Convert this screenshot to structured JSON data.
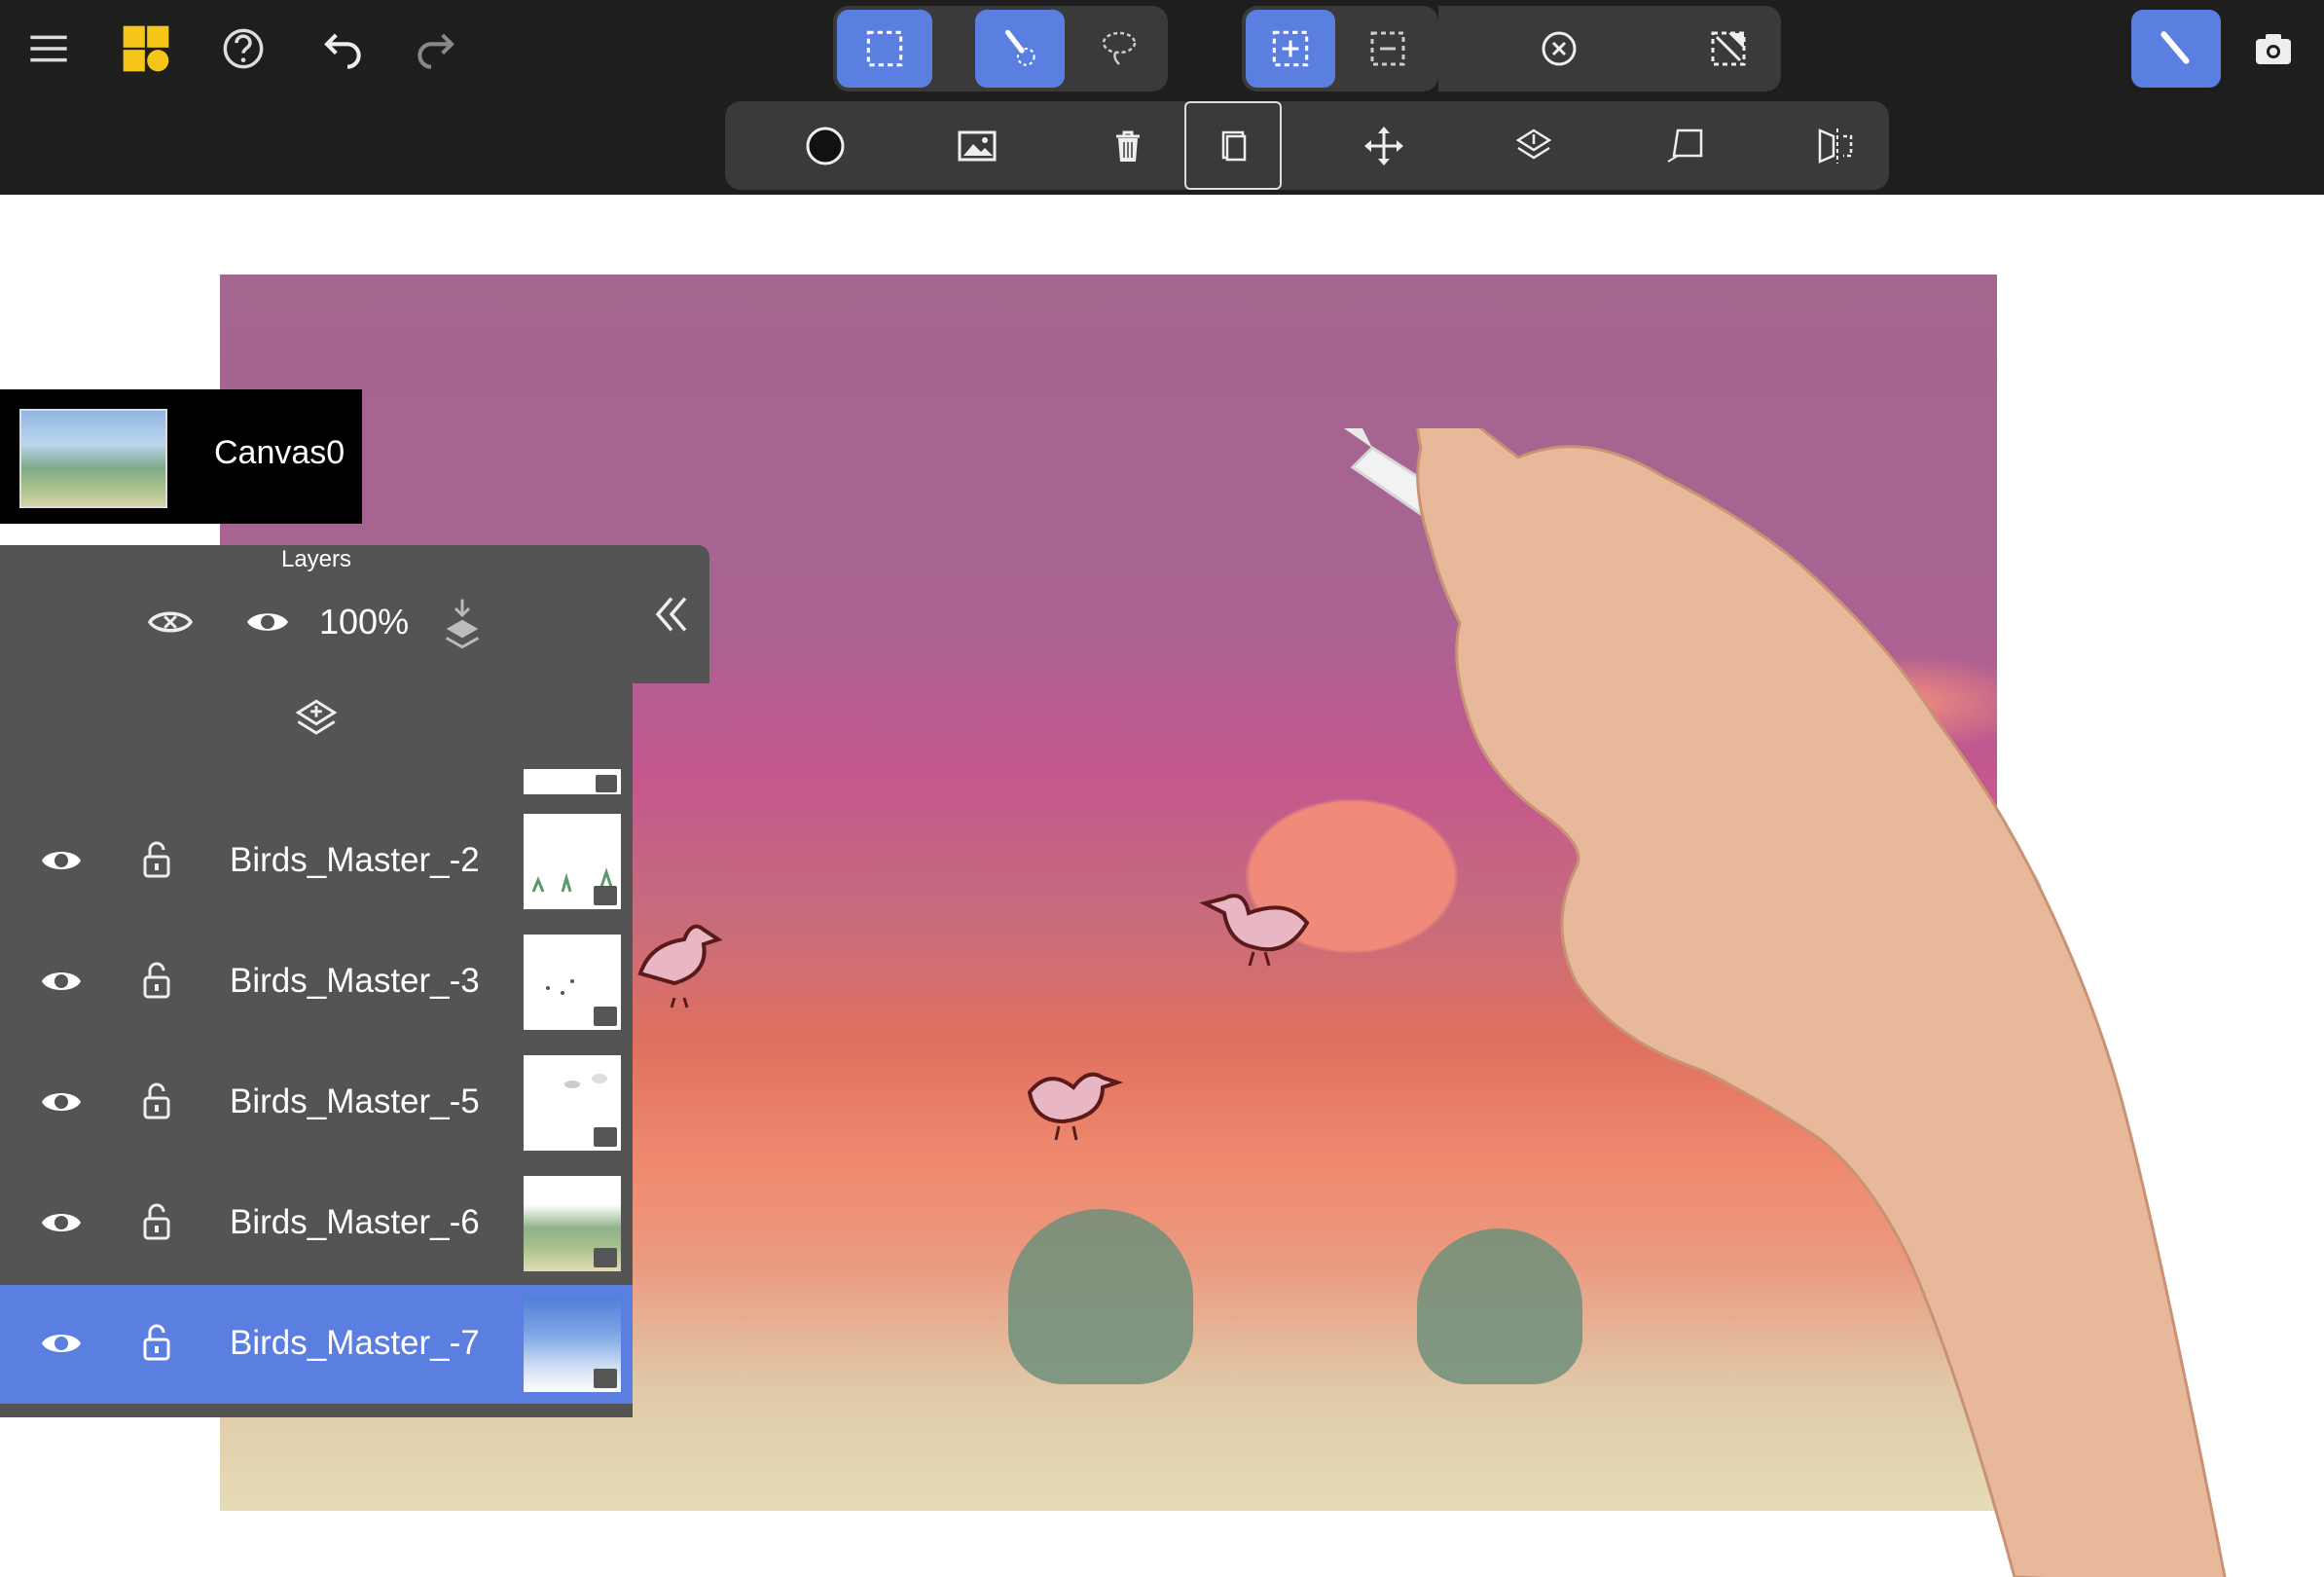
{
  "toolbar": {
    "left_icons": [
      "menu-icon",
      "apps-grid-icon",
      "help-icon",
      "undo-icon",
      "redo-icon"
    ],
    "selection_group": [
      "rectangle-select-icon",
      "brush-select-icon",
      "lasso-select-icon"
    ],
    "modifier_group": [
      "add-selection-icon",
      "subtract-selection-icon"
    ],
    "clear_selection": "clear-selection-icon",
    "invert": "invert-selection-icon",
    "right_icons": [
      "pen-mode-icon",
      "camera-icon"
    ],
    "row2": [
      "circle-icon",
      "image-icon",
      "trash-icon",
      "duplicate-icon",
      "move-icon",
      "layer-merge-icon",
      "perspective-icon",
      "flip-icon"
    ],
    "accent": "#5b7fe0"
  },
  "canvas": {
    "name": "Canvas0"
  },
  "layers": {
    "title": "Layers",
    "opacity": "100%",
    "items": [
      {
        "name": "Birds_Master_-2",
        "visible": true,
        "active": false
      },
      {
        "name": "Birds_Master_-3",
        "visible": true,
        "active": false
      },
      {
        "name": "Birds_Master_-5",
        "visible": true,
        "active": false
      },
      {
        "name": "Birds_Master_-6",
        "visible": true,
        "active": false
      },
      {
        "name": "Birds_Master_-7",
        "visible": true,
        "active": true
      }
    ]
  }
}
